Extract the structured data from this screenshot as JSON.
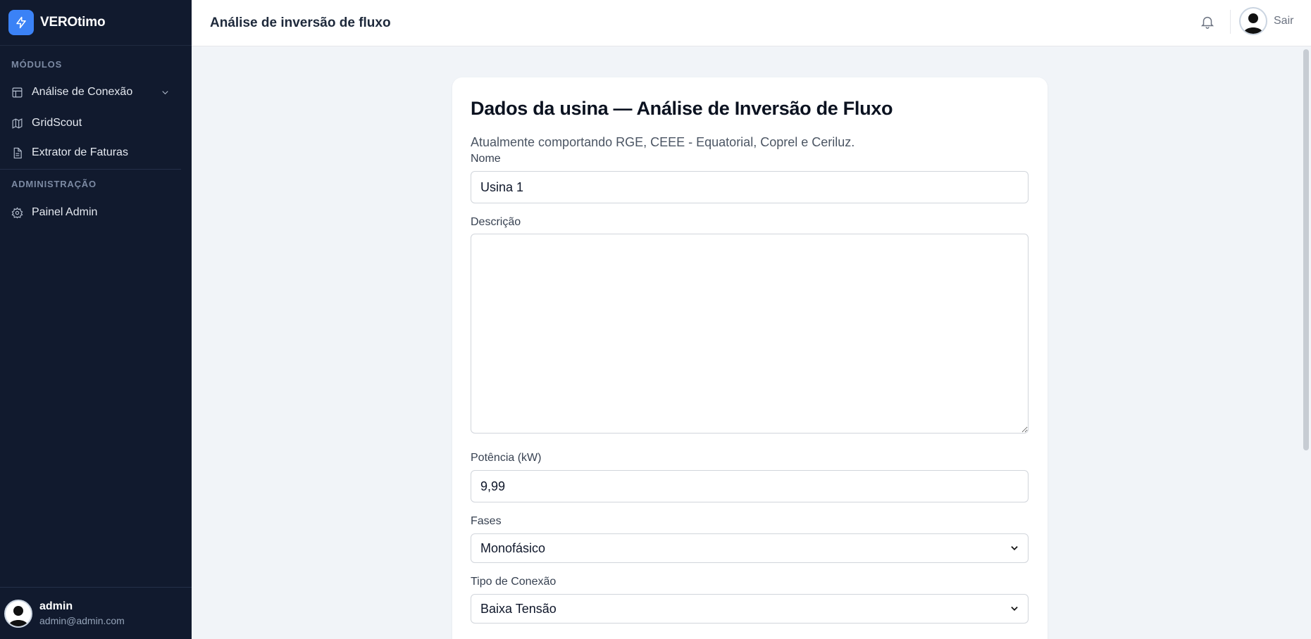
{
  "brand": {
    "name": "VEROtimo"
  },
  "sidebar": {
    "section_modules": "MÓDULOS",
    "section_admin": "ADMINISTRAÇÃO",
    "items": [
      {
        "label": "Análise de Conexão",
        "icon": "table-icon"
      },
      {
        "label": "GridScout",
        "icon": "map-icon"
      },
      {
        "label": "Extrator de Faturas",
        "icon": "file-icon"
      },
      {
        "label": "Painel Admin",
        "icon": "gear-icon"
      }
    ],
    "user": {
      "name": "admin",
      "email": "admin@admin.com"
    }
  },
  "header": {
    "title": "Análise de inversão de fluxo",
    "logout_label": "Sair"
  },
  "form": {
    "title": "Dados da usina — Análise de Inversão de Fluxo",
    "subtitle": "Atualmente comportando RGE, CEEE - Equatorial, Coprel e Ceriluz.",
    "nome_label": "Nome",
    "nome_value": "Usina 1",
    "descricao_label": "Descrição",
    "descricao_value": "",
    "potencia_label": "Potência (kW)",
    "potencia_value": "9,99",
    "fases_label": "Fases",
    "fases_value": "Monofásico",
    "tipo_label": "Tipo de Conexão",
    "tipo_value": "Baixa Tensão"
  },
  "colors": {
    "sidebar_bg": "#111a2e",
    "accent": "#3b82f6",
    "page_bg": "#f1f4f8"
  }
}
